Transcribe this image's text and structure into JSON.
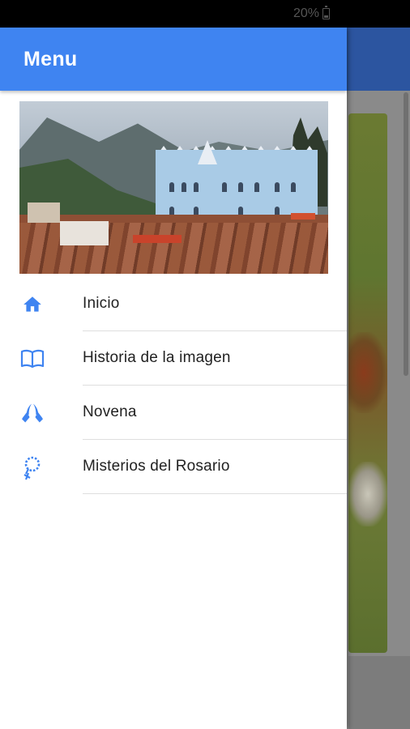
{
  "status_bar": {
    "battery_text": "20%"
  },
  "drawer": {
    "title": "Menu",
    "items": [
      {
        "label": "Inicio",
        "icon": "home-icon"
      },
      {
        "label": "Historia de la imagen",
        "icon": "book-icon"
      },
      {
        "label": "Novena",
        "icon": "praying-hands-icon"
      },
      {
        "label": "Misterios del Rosario",
        "icon": "rosary-icon"
      }
    ]
  },
  "colors": {
    "accent": "#3f84f1",
    "icon": "#3f84f1",
    "text": "#222222",
    "divider": "#dedede"
  }
}
